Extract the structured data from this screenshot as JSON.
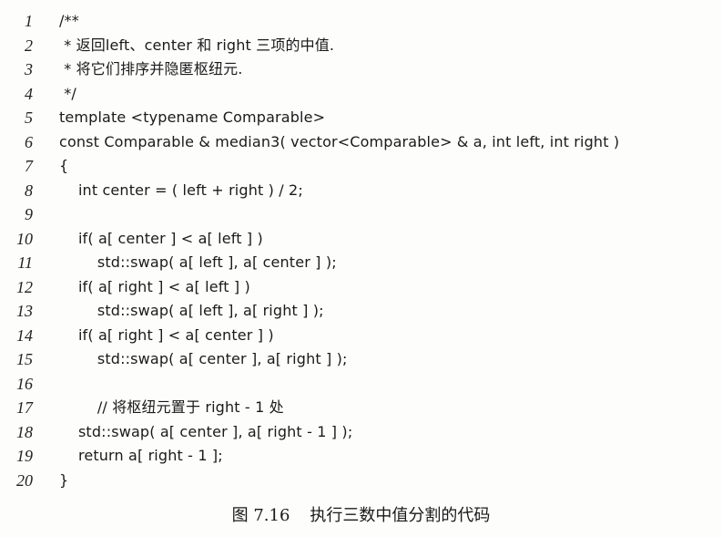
{
  "code_lines": [
    {
      "num": "1",
      "text": "/**"
    },
    {
      "num": "2",
      "text": " * 返回left、center 和 right 三项的中值."
    },
    {
      "num": "3",
      "text": " * 将它们排序并隐匿枢纽元."
    },
    {
      "num": "4",
      "text": " */"
    },
    {
      "num": "5",
      "text": "template <typename Comparable>"
    },
    {
      "num": "6",
      "text": "const Comparable & median3( vector<Comparable> & a, int left, int right )"
    },
    {
      "num": "7",
      "text": "{"
    },
    {
      "num": "8",
      "text": "    int center = ( left + right ) / 2;"
    },
    {
      "num": "9",
      "text": ""
    },
    {
      "num": "10",
      "text": "    if( a[ center ] < a[ left ] )"
    },
    {
      "num": "11",
      "text": "        std::swap( a[ left ], a[ center ] );"
    },
    {
      "num": "12",
      "text": "    if( a[ right ] < a[ left ] )"
    },
    {
      "num": "13",
      "text": "        std::swap( a[ left ], a[ right ] );"
    },
    {
      "num": "14",
      "text": "    if( a[ right ] < a[ center ] )"
    },
    {
      "num": "15",
      "text": "        std::swap( a[ center ], a[ right ] );"
    },
    {
      "num": "16",
      "text": ""
    },
    {
      "num": "17",
      "text": "        // 将枢纽元置于 right - 1 处"
    },
    {
      "num": "18",
      "text": "    std::swap( a[ center ], a[ right - 1 ] );"
    },
    {
      "num": "19",
      "text": "    return a[ right - 1 ];"
    },
    {
      "num": "20",
      "text": "}"
    }
  ],
  "caption": {
    "label": "图 7.16",
    "text": "执行三数中值分割的代码"
  }
}
